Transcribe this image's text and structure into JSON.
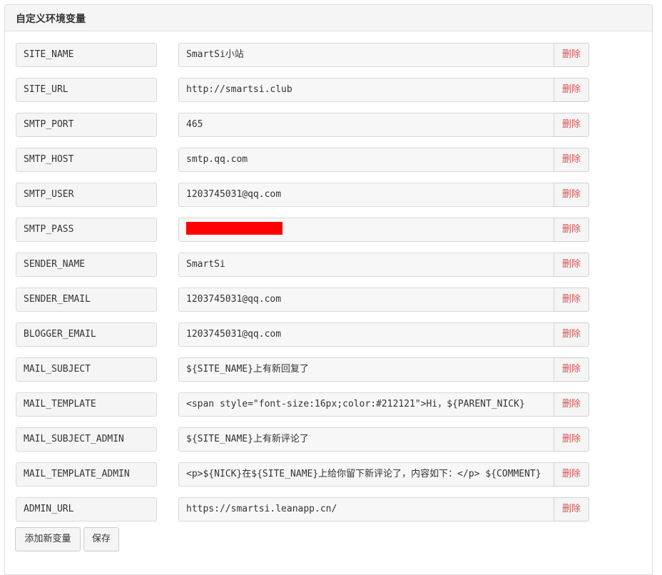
{
  "panel": {
    "title": "自定义环境变量"
  },
  "env_vars": [
    {
      "key": "SITE_NAME",
      "value": "SmartSi小站"
    },
    {
      "key": "SITE_URL",
      "value": "http://smartsi.club"
    },
    {
      "key": "SMTP_PORT",
      "value": "465"
    },
    {
      "key": "SMTP_HOST",
      "value": "smtp.qq.com"
    },
    {
      "key": "SMTP_USER",
      "value": "1203745031@qq.com"
    },
    {
      "key": "SMTP_PASS",
      "value": ""
    },
    {
      "key": "SENDER_NAME",
      "value": "SmartSi"
    },
    {
      "key": "SENDER_EMAIL",
      "value": "1203745031@qq.com"
    },
    {
      "key": "BLOGGER_EMAIL",
      "value": "1203745031@qq.com"
    },
    {
      "key": "MAIL_SUBJECT",
      "value": "${SITE_NAME}上有新回复了"
    },
    {
      "key": "MAIL_TEMPLATE",
      "value": "<span style=\"font-size:16px;color:#212121\">Hi，${PARENT_NICK}"
    },
    {
      "key": "MAIL_SUBJECT_ADMIN",
      "value": "${SITE_NAME}上有新评论了"
    },
    {
      "key": "MAIL_TEMPLATE_ADMIN",
      "value": "<p>${NICK}在${SITE_NAME}上给你留下新评论了，内容如下：</p> ${COMMENT}"
    },
    {
      "key": "ADMIN_URL",
      "value": "https://smartsi.leanapp.cn/"
    }
  ],
  "delete_label": "删除",
  "actions": {
    "add_label": "添加新变量",
    "save_label": "保存"
  },
  "colors": {
    "delete_text": "#d9534f",
    "redaction": "#ff0000"
  }
}
